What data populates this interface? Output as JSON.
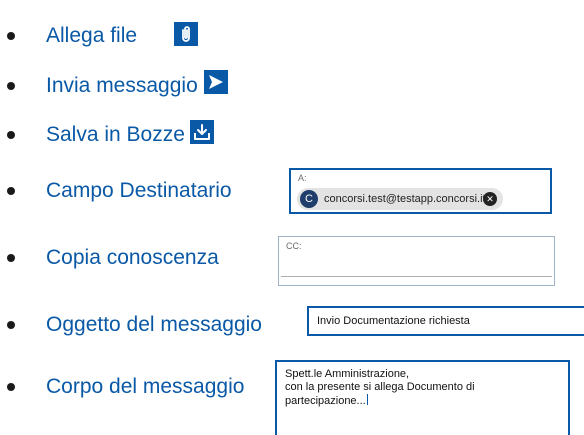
{
  "items": [
    {
      "label": "Allega file",
      "icon": "paperclip-icon"
    },
    {
      "label": "Invia messaggio",
      "icon": "send-icon"
    },
    {
      "label": "Salva in Bozze",
      "icon": "download-tray-icon"
    },
    {
      "label": "Campo Destinatario"
    },
    {
      "label": "Copia conoscenza"
    },
    {
      "label": "Oggetto del messaggio"
    },
    {
      "label": "Corpo del messaggio"
    }
  ],
  "recipient_field": {
    "label": "A:",
    "chip_initial": "C",
    "chip_email": "concorsi.test@testapp.concorsi.it",
    "remove_icon": "close-circle-icon"
  },
  "cc_field": {
    "label": "CC:"
  },
  "subject_field": {
    "value": "Invio Documentazione richiesta"
  },
  "body_field": {
    "lines": [
      "Spett.le Amministrazione,",
      "con la presente si allega Documento di",
      "partecipazione..."
    ]
  },
  "colors": {
    "accent": "#0a59a6",
    "chip_bg": "#e3e3e3",
    "avatar": "#1f3e6b"
  }
}
